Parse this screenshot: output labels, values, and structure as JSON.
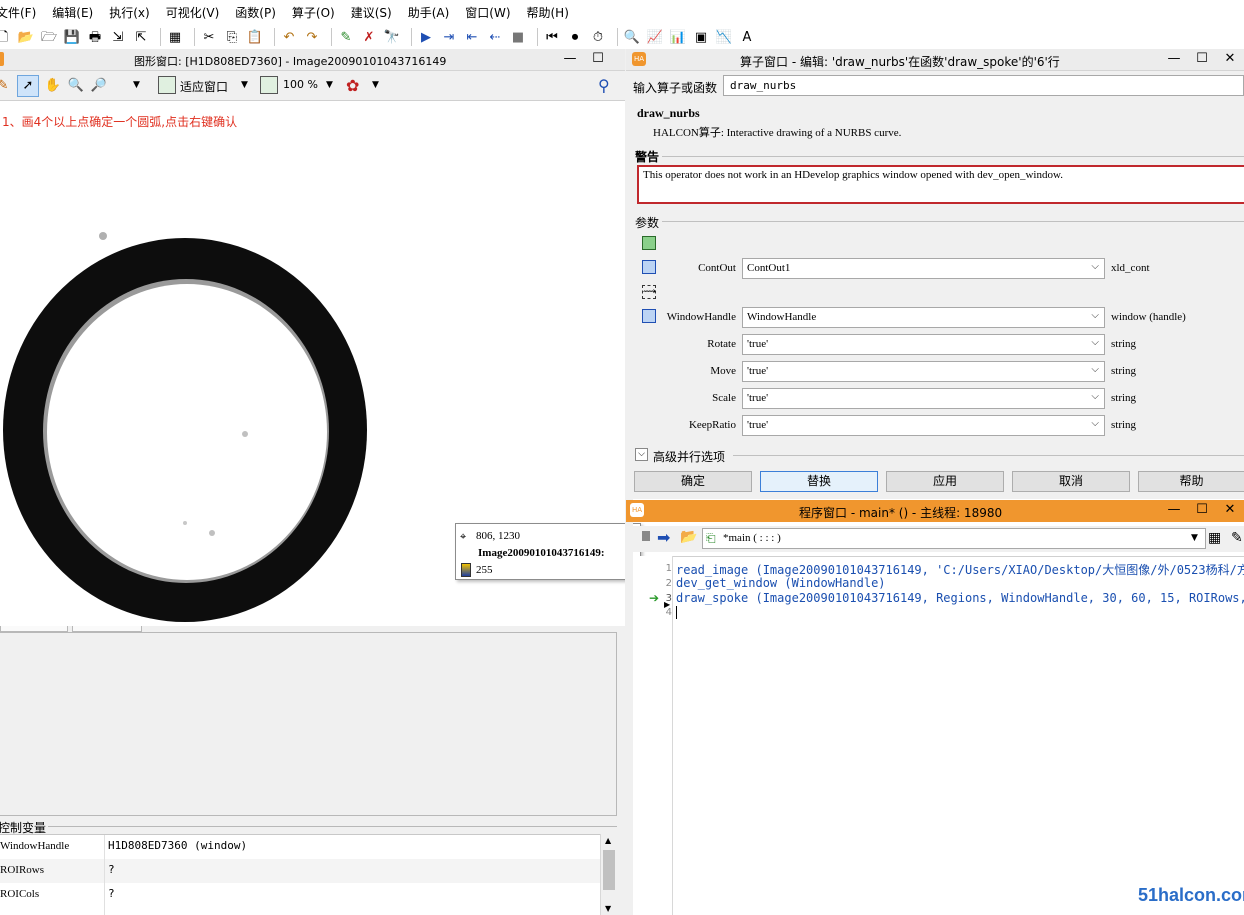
{
  "menu": [
    "文件(F)",
    "编辑(E)",
    "执行(x)",
    "可视化(V)",
    "函数(P)",
    "算子(O)",
    "建议(S)",
    "助手(A)",
    "窗口(W)",
    "帮助(H)"
  ],
  "graphics_window": {
    "title": "图形窗口: [H1D808ED7360] - Image20090101043716149",
    "fit_label": "适应窗口",
    "zoom_label": "100 %",
    "hint": "1、画4个以上点确定一个圆弧,点击右键确认",
    "tooltip": {
      "coords": "806, 1230",
      "image_name": "Image20090101043716149:",
      "value": "255"
    }
  },
  "control_variables": {
    "label": "控制变量",
    "rows": [
      {
        "name": "WindowHandle",
        "value": "H1D808ED7360 (window)"
      },
      {
        "name": "ROIRows",
        "value": "?"
      },
      {
        "name": "ROICols",
        "value": "?"
      }
    ]
  },
  "operator_window": {
    "title": "算子窗口 - 编辑: 'draw_nurbs'在函数'draw_spoke'的'6'行",
    "input_label": "输入算子或函数",
    "input_value": "draw_nurbs",
    "op_name": "draw_nurbs",
    "op_desc": "HALCON算子: Interactive drawing of a NURBS curve.",
    "warning_label": "警告",
    "warning_text": "This operator does not work in an HDevelop graphics window opened with dev_open_window.",
    "params_label": "参数",
    "params": [
      {
        "name": "ContOut",
        "value": "ContOut1",
        "type": "xld_cont"
      },
      {
        "name": "WindowHandle",
        "value": "WindowHandle",
        "type": "window (handle)"
      },
      {
        "name": "Rotate",
        "value": "'true'",
        "type": "string"
      },
      {
        "name": "Move",
        "value": "'true'",
        "type": "string"
      },
      {
        "name": "Scale",
        "value": "'true'",
        "type": "string"
      },
      {
        "name": "KeepRatio",
        "value": "'true'",
        "type": "string"
      }
    ],
    "advanced_label": "高级并行选项",
    "buttons": [
      "确定",
      "替换",
      "应用",
      "取消",
      "帮助"
    ]
  },
  "program_window": {
    "title": "程序窗口 - main* () - 主线程: 18980",
    "procedure": "*main ( : : : )",
    "lines": [
      {
        "num": "1",
        "code": "read_image (Image20090101043716149, 'C:/Users/XIAO/Desktop/大恒图像/外/0523杨科/方"
      },
      {
        "num": "2",
        "code": "dev_get_window (WindowHandle)"
      },
      {
        "num": "3",
        "code": "draw_spoke (Image20090101043716149, Regions, WindowHandle, 30, 60, 15, ROIRows, R"
      },
      {
        "num": "4",
        "code": ""
      }
    ]
  },
  "watermark": "51halcon.com",
  "colors": {
    "hint": "#e03020",
    "program_title": "#f0962e",
    "code": "#1a4fb0",
    "warning_border": "#c0282d"
  }
}
